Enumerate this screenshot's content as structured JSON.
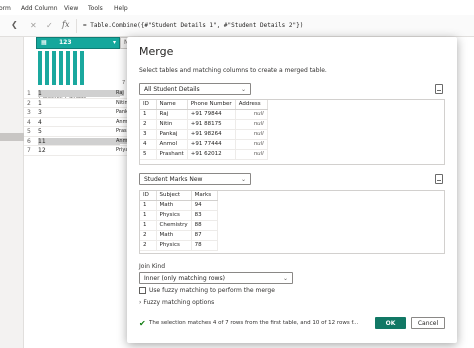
{
  "ribbon": {
    "items": [
      "orm",
      "Add Column",
      "View",
      "Tools",
      "Help"
    ]
  },
  "formula_bar": {
    "formula": "= Table.Combine({#\"Student Details 1\", #\"Student Details 2\"})"
  },
  "grid": {
    "column_name": "ID",
    "column_type": "123",
    "column2_name": "N",
    "stats": "7 distinct, 7 unique",
    "stats2": "7 di",
    "rows": [
      {
        "n": "1",
        "id": "1",
        "c2": "Raj"
      },
      {
        "n": "2",
        "id": "1",
        "c2": "Nitin"
      },
      {
        "n": "3",
        "id": "3",
        "c2": "Pank"
      },
      {
        "n": "4",
        "id": "4",
        "c2": "Anm"
      },
      {
        "n": "5",
        "id": "5",
        "c2": "Pras"
      },
      {
        "n": "6",
        "id": "11",
        "c2": "Anm"
      },
      {
        "n": "7",
        "id": "12",
        "c2": "Priya"
      }
    ]
  },
  "dialog": {
    "title": "Merge",
    "subtitle": "Select tables and matching columns to create a merged table.",
    "table1_select": "All Student Details",
    "table1": {
      "headers": [
        "ID",
        "Name",
        "Phone Number",
        "Address"
      ],
      "rows": [
        [
          "1",
          "Raj",
          "+91 79844",
          "null"
        ],
        [
          "2",
          "Nitin",
          "+91 88175",
          "null"
        ],
        [
          "3",
          "Pankaj",
          "+91 98264",
          "null"
        ],
        [
          "4",
          "Anmol",
          "+91 77444",
          "null"
        ],
        [
          "5",
          "Prashant",
          "+91 62012",
          "null"
        ]
      ]
    },
    "table2_select": "Student Marks New",
    "table2": {
      "headers": [
        "ID",
        "Subject",
        "Marks"
      ],
      "rows": [
        [
          "1",
          "Math",
          "94"
        ],
        [
          "1",
          "Physics",
          "83"
        ],
        [
          "1",
          "Chemistry",
          "88"
        ],
        [
          "2",
          "Math",
          "87"
        ],
        [
          "2",
          "Physics",
          "78"
        ]
      ]
    },
    "join_kind_label": "Join Kind",
    "join_kind_value": "Inner (only matching rows)",
    "fuzzy_checkbox_label": "Use fuzzy matching to perform the merge",
    "fuzzy_options_label": "Fuzzy matching options",
    "status_text": "The selection matches 4 of 7 rows from the first table, and 10 of 12 rows f...",
    "ok_label": "OK",
    "cancel_label": "Cancel"
  },
  "colors": {
    "accent": "#117865",
    "column_header": "#15a79c",
    "status_ok": "#107c10"
  },
  "icons": {
    "back": "chevron-left-icon",
    "cancel": "x-icon",
    "commit": "check-icon",
    "fx": "fx-icon",
    "file": "file-icon",
    "status": "check-icon",
    "expand": "chevron-right-icon"
  }
}
